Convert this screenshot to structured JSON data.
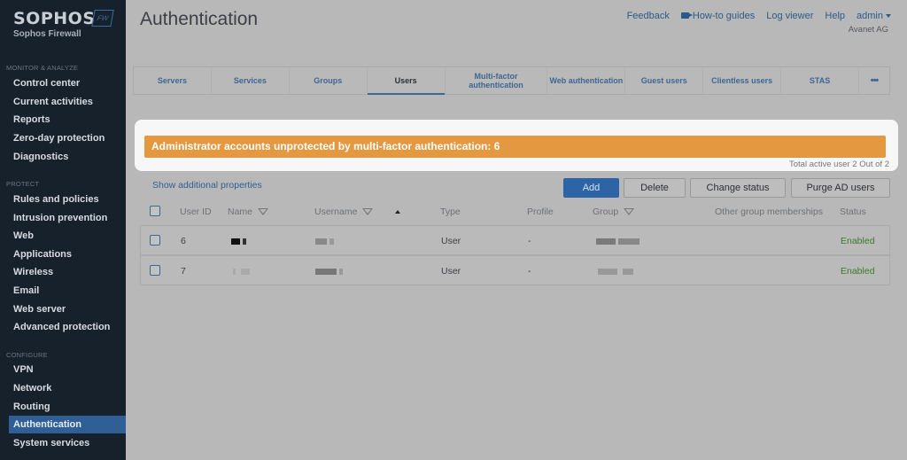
{
  "brand": {
    "name": "SOPHOS",
    "badge": "FW",
    "product": "Sophos Firewall"
  },
  "sidebar": {
    "sections": [
      {
        "title": "MONITOR & ANALYZE",
        "items": [
          "Control center",
          "Current activities",
          "Reports",
          "Zero-day protection",
          "Diagnostics"
        ]
      },
      {
        "title": "PROTECT",
        "items": [
          "Rules and policies",
          "Intrusion prevention",
          "Web",
          "Applications",
          "Wireless",
          "Email",
          "Web server",
          "Advanced protection"
        ]
      },
      {
        "title": "CONFIGURE",
        "items": [
          "VPN",
          "Network",
          "Routing",
          "Authentication",
          "System services"
        ]
      }
    ],
    "active_item": "Authentication"
  },
  "header": {
    "title": "Authentication",
    "links": {
      "feedback": "Feedback",
      "howto": "How-to guides",
      "logviewer": "Log viewer",
      "help": "Help",
      "user": "admin"
    },
    "organization": "Avanet AG"
  },
  "tabs": [
    {
      "label": "Servers",
      "active": false
    },
    {
      "label": "Services",
      "active": false
    },
    {
      "label": "Groups",
      "active": false
    },
    {
      "label": "Users",
      "active": true
    },
    {
      "label": "Multi-factor authentication",
      "active": false
    },
    {
      "label": "Web authentication",
      "active": false
    },
    {
      "label": "Guest users",
      "active": false
    },
    {
      "label": "Clientless users",
      "active": false
    },
    {
      "label": "STAS",
      "active": false
    },
    {
      "label": "•••",
      "active": false
    }
  ],
  "alert": {
    "message": "Administrator accounts unprotected by multi-factor authentication: 6",
    "summary": "Total active user 2 Out of 2",
    "color": "#e49840"
  },
  "toolbar": {
    "show_properties": "Show additional properties",
    "add": "Add",
    "delete": "Delete",
    "change_status": "Change status",
    "purge": "Purge AD users"
  },
  "table": {
    "columns": [
      "User ID",
      "Name",
      "Username",
      "Type",
      "Profile",
      "Group",
      "Other group memberships",
      "Status"
    ],
    "rows": [
      {
        "id": "6",
        "name": "[redacted]",
        "username": "[redacted]",
        "type": "User",
        "profile": "-",
        "group": "[redacted]",
        "other": "",
        "status": "Enabled"
      },
      {
        "id": "7",
        "name": "[redacted]",
        "username": "[redacted]",
        "type": "User",
        "profile": "-",
        "group": "[redacted]",
        "other": "",
        "status": "Enabled"
      }
    ]
  }
}
